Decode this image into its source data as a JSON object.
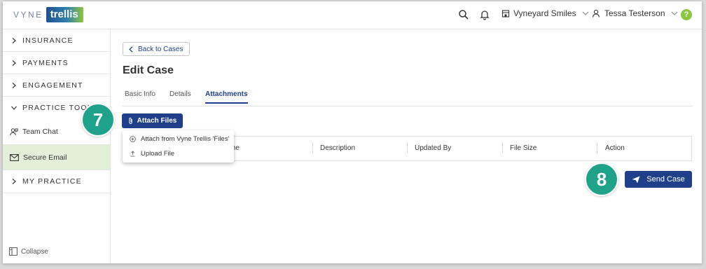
{
  "brand": {
    "vyne": "VYNE",
    "trellis": "trellis"
  },
  "header": {
    "practice": "Vyneyard Smiles",
    "user": "Tessa Testerson",
    "help": "?"
  },
  "sidebar": {
    "sections": [
      {
        "label": "INSURANCE",
        "expanded": false
      },
      {
        "label": "PAYMENTS",
        "expanded": false
      },
      {
        "label": "ENGAGEMENT",
        "expanded": false
      },
      {
        "label": "PRACTICE TOOLS",
        "expanded": true
      }
    ],
    "items": [
      {
        "label": "Team Chat",
        "icon": "team-chat-icon",
        "active": false
      },
      {
        "label": "Secure Email",
        "icon": "mail-icon",
        "active": true
      }
    ],
    "last_section": {
      "label": "MY PRACTICE",
      "expanded": false
    },
    "collapse": "Collapse"
  },
  "main": {
    "back": "Back to Cases",
    "title": "Edit Case",
    "tabs": [
      {
        "label": "Basic Info",
        "active": false
      },
      {
        "label": "Details",
        "active": false
      },
      {
        "label": "Attachments",
        "active": true
      }
    ],
    "attach_button": "Attach Files",
    "dropdown": [
      {
        "label": "Attach from Vyne Trellis 'Files'",
        "icon": "plus-circle-icon"
      },
      {
        "label": "Upload File",
        "icon": "upload-icon"
      }
    ],
    "table_headers": [
      "me",
      "Description",
      "Updated By",
      "File Size",
      "Action"
    ],
    "send_button": "Send Case"
  },
  "steps": [
    "7",
    "8"
  ],
  "colors": {
    "primary": "#1f3f8a",
    "step": "#1ea38a",
    "active_bg": "#e4efd9",
    "help": "#8cc63f"
  }
}
